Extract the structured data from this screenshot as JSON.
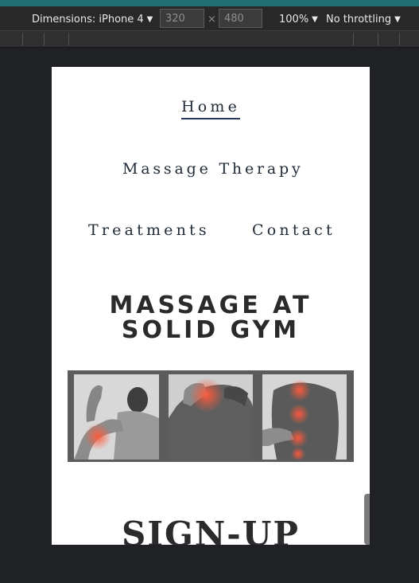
{
  "devtools": {
    "dimensions_label": "Dimensions: iPhone 4",
    "width_value": "320",
    "height_value": "480",
    "times_symbol": "×",
    "zoom_label": "100%",
    "throttling_label": "No throttling",
    "caret": "▼"
  },
  "nav": {
    "home": "Home",
    "massage_therapy": "Massage Therapy",
    "treatments": "Treatments",
    "contact": "Contact"
  },
  "hero": {
    "title_line1": "MASSAGE AT",
    "title_line2": "SOLID GYM"
  },
  "collage": {
    "panels": [
      "arm-elbow-pain",
      "shoulder-pain",
      "back-pain"
    ]
  },
  "signup": {
    "heading": "SIGN-UP"
  },
  "colors": {
    "toolbar_bg": "#282828",
    "accent_teal": "#1f6f73",
    "nav_text": "#1f2a36",
    "nav_underline": "#26365e",
    "pain_highlight": "#ff5a3c"
  },
  "icons": {
    "dropdown": "chevron-down-icon"
  }
}
